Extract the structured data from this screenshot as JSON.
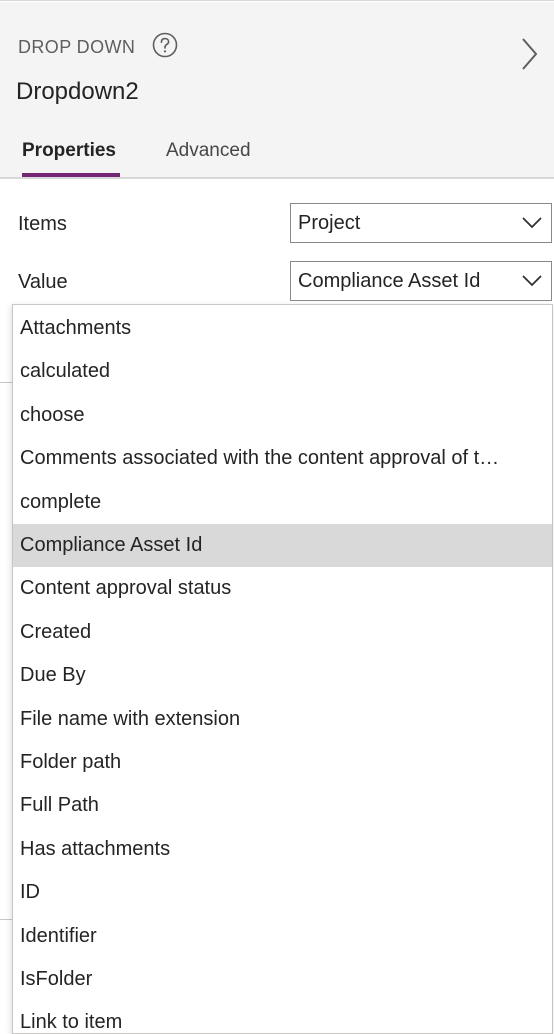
{
  "header": {
    "control_type": "DROP DOWN",
    "control_name": "Dropdown2",
    "icons": {
      "help": "help-circle-icon",
      "expand": "chevron-right-icon"
    }
  },
  "tabs": [
    {
      "label": "Properties",
      "active": true
    },
    {
      "label": "Advanced",
      "active": false
    }
  ],
  "properties": {
    "items": {
      "label": "Items",
      "value": "Project"
    },
    "value": {
      "label": "Value",
      "value": "Compliance Asset Id"
    }
  },
  "dropdown": {
    "selected": "Compliance Asset Id",
    "options": [
      "Attachments",
      "calculated",
      "choose",
      "Comments associated with the content approval of t…",
      "complete",
      "Compliance Asset Id",
      "Content approval status",
      "Created",
      "Due By",
      "File name with extension",
      "Folder path",
      "Full Path",
      "Has attachments",
      "ID",
      "Identifier",
      "IsFolder",
      "Link to item"
    ]
  },
  "colors": {
    "accent": "#742774",
    "header_bg": "#f4f4f4",
    "selected_bg": "#d9d9d9",
    "border": "#8a8886"
  }
}
